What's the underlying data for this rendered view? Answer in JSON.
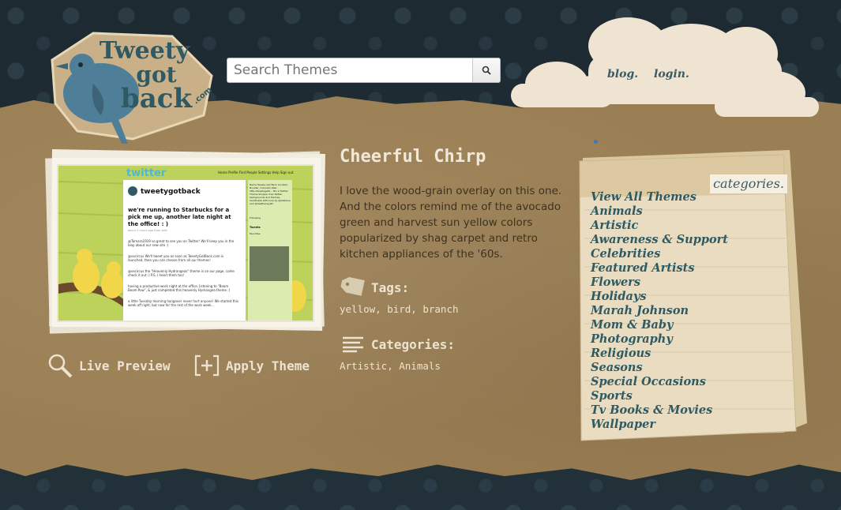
{
  "header": {
    "logo_text": "TweetyGotBack.com",
    "search": {
      "placeholder": "Search Themes",
      "value": ""
    },
    "nav": [
      {
        "label": "blog."
      },
      {
        "label": "login."
      }
    ]
  },
  "theme": {
    "title": "Cheerful Chirp",
    "description": "I love the wood-grain overlay on this one. And the colors remind me of the avocado green and harvest sun yellow colors popularized by shag carpet and retro kitchen appliances of the '60s.",
    "tags_label": "Tags:",
    "tags_value": "yellow, bird, branch",
    "categories_label": "Categories:",
    "categories_value": "Artistic, Animals"
  },
  "actions": {
    "live_preview": "Live Preview",
    "apply_theme": "Apply Theme"
  },
  "preview": {
    "brand": "twitter",
    "nav": "Home  Profile  Find People  Settings  Help  Sign out",
    "user": "tweetygotback",
    "status": "we're running to Starbucks for a pick me up, another late night at the office! : )",
    "status_meta": "about 5 hours ago from web",
    "tweets": [
      "@Tamara1919 so great to see you on Twitter! We'll keep you in the loop about our new site :)",
      "@xxcircus We'll tweet you as soon as TweetyGotBack.com is launched, then you can choose from all our themes!",
      "@xxcircus the \"Heavenly Hydrangeas\" theme is on our page, come check it out :) P.S. I heart them too!",
      "having a productive work night at the office, listening to \"Boom Boom Pow\", & just completed this heavenly Hydrangea theme :)",
      "a little Tuesday morning hangover never hurt anyone! We started this week off right, but now for the rest of the work week..."
    ],
    "side_info": "Name Tweety Got Back Location Boulder, Colorado Web http://tweetygotb... Bio A Twitter Theme Shoppe, free Twitter backgrounds and themes, handmade with love by @elisheva and @heatherwyatt",
    "side_following": "Following",
    "side_tweets": "Tweets",
    "side_favorites": "Favorites"
  },
  "categories": {
    "heading": "categories.",
    "items": [
      "View All Themes",
      "Animals",
      "Artistic",
      "Awareness & Support",
      "Celebrities",
      "Featured Artists",
      "Flowers",
      "Holidays",
      "Marah Johnson",
      "Mom & Baby",
      "Photography",
      "Religious",
      "Seasons",
      "Special Occasions",
      "Sports",
      "Tv Books & Movies",
      "Wallpaper"
    ]
  },
  "colors": {
    "paper": "#9b7f54",
    "background": "#1f2a31",
    "link": "#2f5a63",
    "cloud": "#efe3d2"
  }
}
